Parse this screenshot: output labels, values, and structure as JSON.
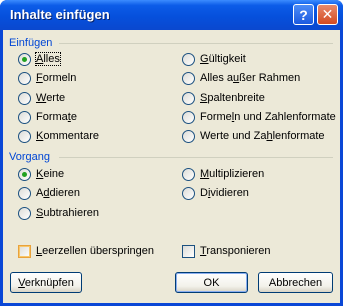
{
  "window": {
    "title": "Inhalte einfügen",
    "help_glyph": "?",
    "close_glyph": "✕"
  },
  "paste": {
    "section_label": "Einfügen",
    "options": [
      {
        "pre": "",
        "u": "A",
        "post": "lles",
        "checked": true
      },
      {
        "pre": "",
        "u": "F",
        "post": "ormeln",
        "checked": false
      },
      {
        "pre": "",
        "u": "W",
        "post": "erte",
        "checked": false
      },
      {
        "pre": "Forma",
        "u": "t",
        "post": "e",
        "checked": false
      },
      {
        "pre": "",
        "u": "K",
        "post": "ommentare",
        "checked": false
      },
      {
        "pre": "",
        "u": "G",
        "post": "ültigkeit",
        "checked": false
      },
      {
        "pre": "Alles a",
        "u": "u",
        "post": "ßer Rahmen",
        "checked": false
      },
      {
        "pre": "",
        "u": "S",
        "post": "paltenbreite",
        "checked": false
      },
      {
        "pre": "Forme",
        "u": "l",
        "post": "n und Zahlenformate",
        "checked": false
      },
      {
        "pre": "Werte und Za",
        "u": "h",
        "post": "lenformate",
        "checked": false
      }
    ]
  },
  "operation": {
    "section_label": "Vorgang",
    "options": [
      {
        "pre": "",
        "u": "K",
        "post": "eine",
        "checked": true
      },
      {
        "pre": "A",
        "u": "d",
        "post": "dieren",
        "checked": false
      },
      {
        "pre": "",
        "u": "S",
        "post": "ubtrahieren",
        "checked": false
      },
      {
        "pre": "",
        "u": "M",
        "post": "ultiplizieren",
        "checked": false
      },
      {
        "pre": "D",
        "u": "i",
        "post": "vidieren",
        "checked": false
      }
    ]
  },
  "checks": {
    "skip_blanks": {
      "pre": "",
      "u": "L",
      "post": "eerzellen überspringen",
      "checked": false
    },
    "transpose": {
      "pre": "",
      "u": "T",
      "post": "ransponieren",
      "checked": false
    }
  },
  "buttons": {
    "link": {
      "pre": "",
      "u": "V",
      "post": "erknüpfen"
    },
    "ok": "OK",
    "cancel": "Abbrechen"
  }
}
